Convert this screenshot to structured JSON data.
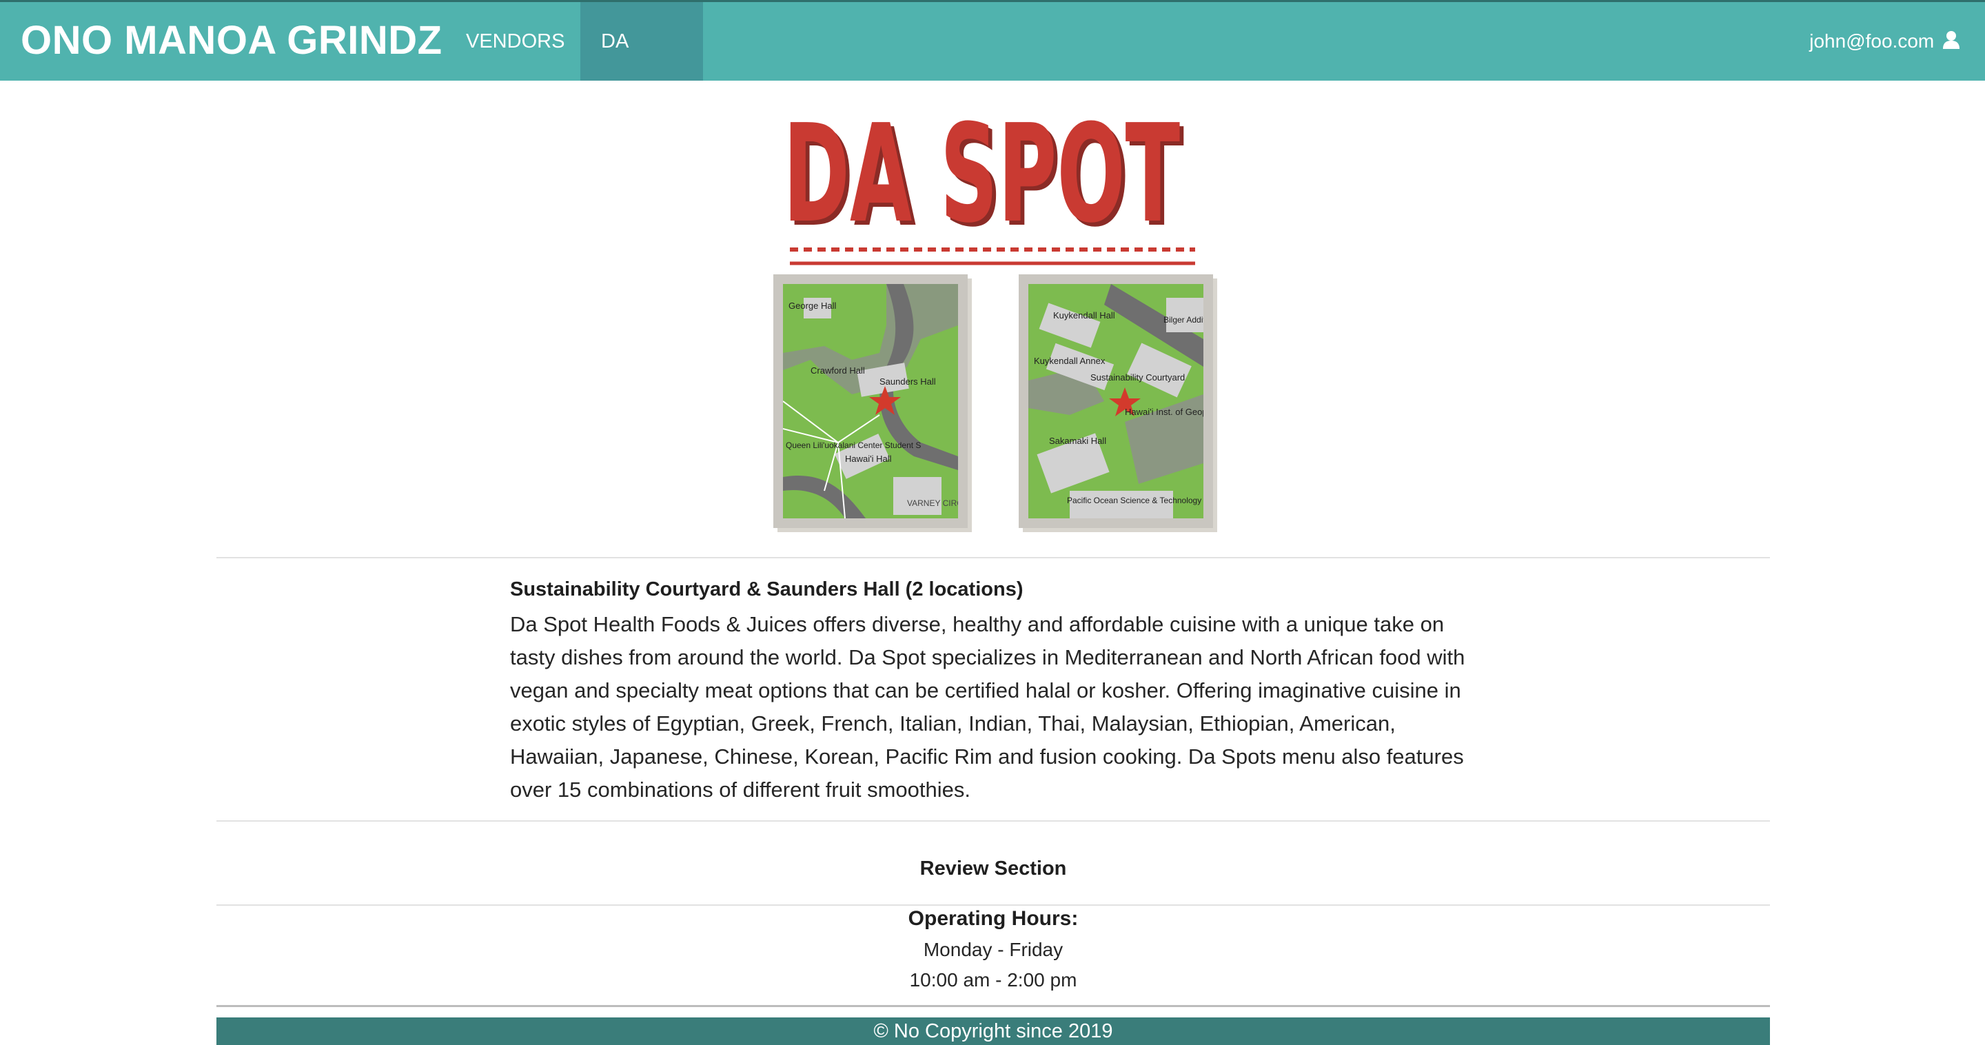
{
  "navbar": {
    "brand": "ONO MANOA GRINDZ",
    "items": [
      {
        "label": "VENDORS"
      },
      {
        "label": "DA SPOT",
        "active": true
      }
    ],
    "user_email": "john@foo.com",
    "user_icon": "user-icon",
    "bg_color": "#50b3ae",
    "active_color": "#43979a"
  },
  "hero": {
    "logo_text": "DA SPOT",
    "logo_color": "#c93a32"
  },
  "maps": [
    {
      "labels": [
        "George Hall",
        "Crawford Hall",
        "Saunders Hall",
        "Queen Lili'uokalani Center Student S",
        "Hawai'i Hall",
        "VARNEY CIRCLE"
      ]
    },
    {
      "labels": [
        "Kuykendall Hall",
        "Kuykendall Annex",
        "Sustainability Courtyard",
        "Hawai'i Inst. of Geophysics",
        "Sakamaki Hall",
        "Pacific Ocean Science & Technology",
        "Bilger Addition"
      ]
    }
  ],
  "description": {
    "title": "Sustainability Courtyard & Saunders Hall (2 locations)",
    "body": "Da Spot Health Foods & Juices offers diverse, healthy and affordable cuisine with a unique take on tasty dishes from around the world. Da Spot specializes in Mediterranean and North African food with vegan and specialty meat options that can be certified halal or kosher. Offering imaginative cuisine in exotic styles of Egyptian, Greek, French, Italian, Indian, Thai, Malaysian, Ethiopian, American, Hawaiian, Japanese, Chinese, Korean, Pacific Rim and fusion cooking. Da Spots menu also features over 15 combinations of different fruit smoothies."
  },
  "review": {
    "title": "Review Section"
  },
  "hours": {
    "title": "Operating Hours:",
    "days": "Monday - Friday",
    "time": "10:00 am - 2:00 pm"
  },
  "footer": {
    "text": "© No Copyright since 2019",
    "bg_color": "#3a7d7a"
  }
}
